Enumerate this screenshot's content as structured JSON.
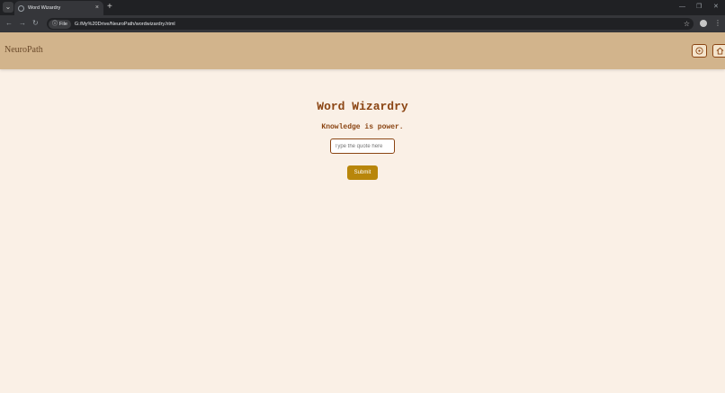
{
  "browser": {
    "tab_title": "Word Wizardry",
    "tab_close": "×",
    "new_tab": "+",
    "search_tabs": "⌄",
    "nav": {
      "back": "←",
      "forward": "→",
      "reload": "↻"
    },
    "chip_label": "File",
    "url": "G:/My%20Drive/NeuroPath/wordwizardry.html",
    "window": {
      "minimize": "—",
      "restore": "❐",
      "close": "✕"
    }
  },
  "app": {
    "brand": "NeuroPath",
    "header_icons": [
      "target-icon",
      "home-icon"
    ]
  },
  "game": {
    "title": "Word Wizardry",
    "quote": "Knowledge is power.",
    "input_placeholder": "Type the quote here",
    "submit_label": "Submit"
  },
  "colors": {
    "page_bg": "#faf0e6",
    "header_bg": "#d2b48c",
    "title": "#8b4513",
    "submit_bg": "#b8860b"
  }
}
